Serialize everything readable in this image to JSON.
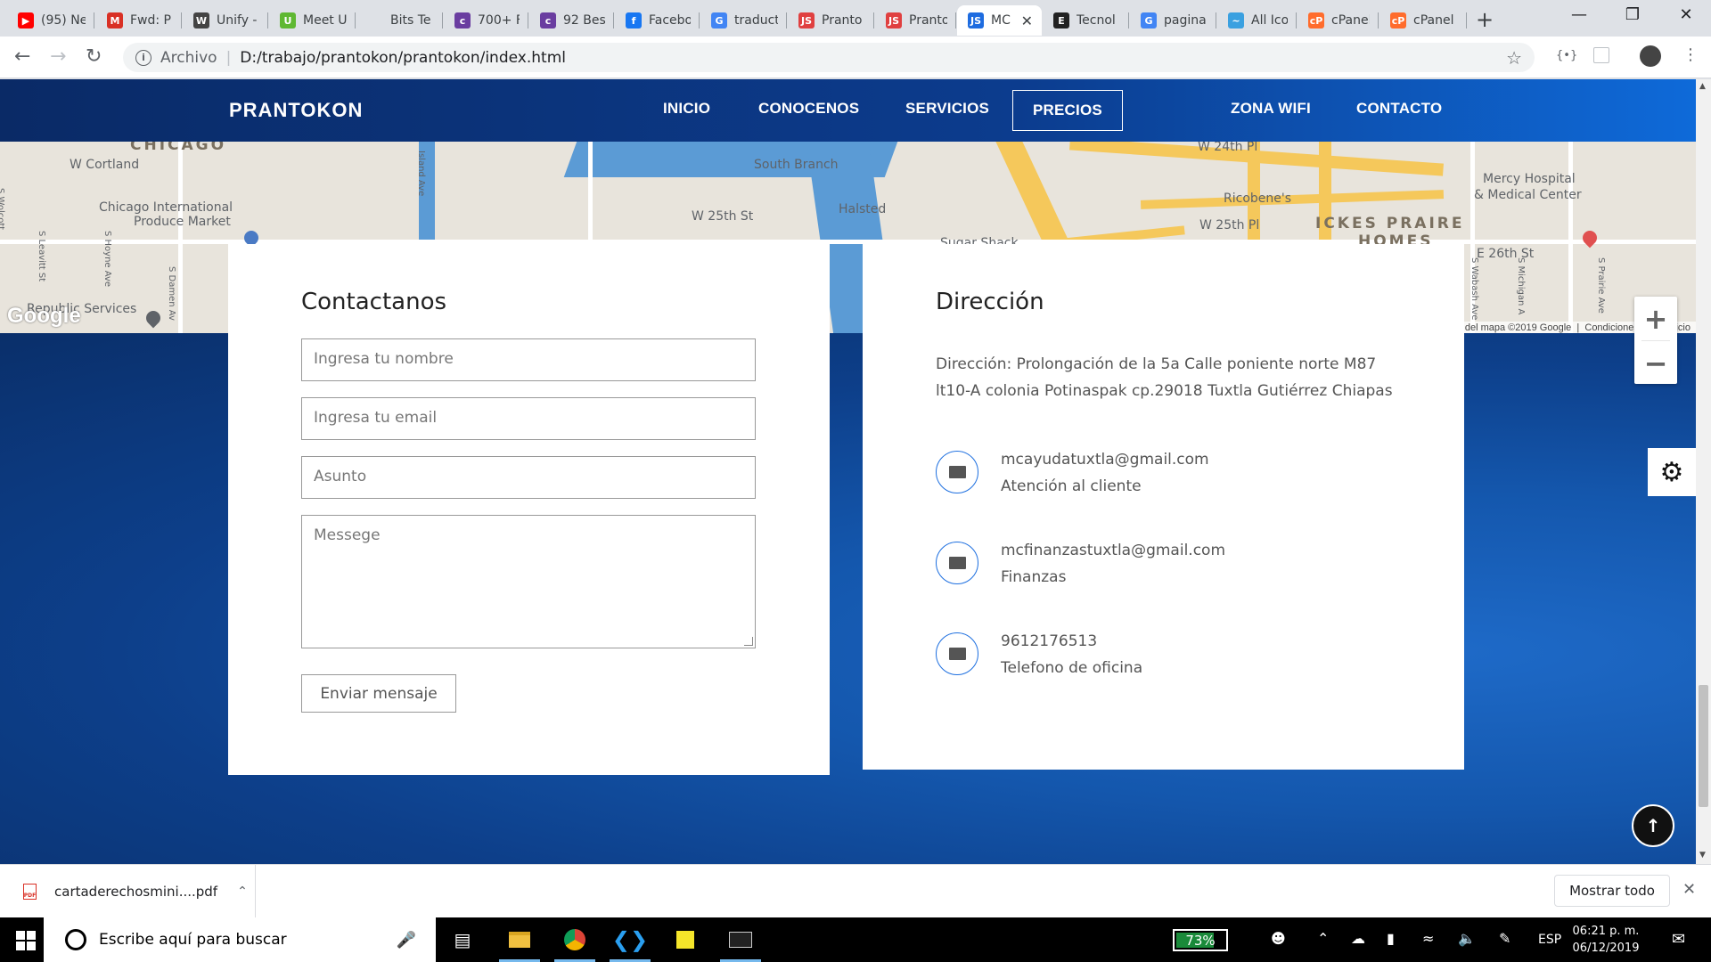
{
  "browser": {
    "tabs": [
      {
        "label": "(95) Ne",
        "icon": "▶",
        "color": "#ff0000"
      },
      {
        "label": "Fwd: P",
        "icon": "M",
        "color": "#d93025"
      },
      {
        "label": "Unify -",
        "icon": "W",
        "color": "#444444"
      },
      {
        "label": "Meet U",
        "icon": "U",
        "color": "#5fb832"
      },
      {
        "label": "Bits Te",
        "icon": "",
        "color": "#dee1e6"
      },
      {
        "label": "700+ F",
        "icon": "c",
        "color": "#6a3da0"
      },
      {
        "label": "92 Bes",
        "icon": "c",
        "color": "#6a3da0"
      },
      {
        "label": "Facebo",
        "icon": "f",
        "color": "#1877f2"
      },
      {
        "label": "traduct",
        "icon": "G",
        "color": "#4285f4"
      },
      {
        "label": "Pranto",
        "icon": "JS",
        "color": "#e04040"
      },
      {
        "label": "Pranto",
        "icon": "JS",
        "color": "#e04040"
      },
      {
        "label": "MC",
        "icon": "JS",
        "color": "#1e6ce0"
      },
      {
        "label": "Tecnol",
        "icon": "E",
        "color": "#222222"
      },
      {
        "label": "pagina",
        "icon": "G",
        "color": "#4285f4"
      },
      {
        "label": "All Icor",
        "icon": "~",
        "color": "#3aa0e0"
      },
      {
        "label": "cPanel",
        "icon": "cP",
        "color": "#ff6c2c"
      },
      {
        "label": "cPanel",
        "icon": "cP",
        "color": "#ff6c2c"
      }
    ],
    "active_tab": 11,
    "address": {
      "scheme_label": "Archivo",
      "url": "D:/trabajo/prantokon/prantokon/index.html"
    }
  },
  "site": {
    "brand": "PRANTOKON",
    "nav": [
      {
        "label": "INICIO",
        "active": false
      },
      {
        "label": "CONOCENOS",
        "active": false
      },
      {
        "label": "SERVICIOS",
        "active": false
      },
      {
        "label": "PRECIOS",
        "active": true
      },
      {
        "label": "ZONA WIFI",
        "active": false
      },
      {
        "label": "CONTACTO",
        "active": false
      }
    ],
    "map": {
      "labels": [
        "CHICAGO",
        "W Cortland",
        "Chicago International",
        "Produce Market",
        "W 25th St",
        "South Branch",
        "Halsted",
        "Sugar Shack",
        "W 24th Pl",
        "W 25th Pl",
        "Ricobene's",
        "ICKES PRAIRE",
        "HOMES",
        "Mercy Hospital",
        "& Medical Center",
        "E 26th St",
        "Republic Services",
        "S Damen Av",
        "S Leavitt St",
        "S Hoyne Ave",
        "S Wabash Ave",
        "S Michigan A",
        "S Prairie Ave",
        "S Wolcott",
        "Island Ave"
      ],
      "logo": "Google",
      "copyright": "Datos del mapa ©2019 Google",
      "terms": "Condiciones del servicio"
    },
    "contact_form": {
      "title": "Contactanos",
      "name_placeholder": "Ingresa tu nombre",
      "email_placeholder": "Ingresa tu email",
      "subject_placeholder": "Asunto",
      "message_placeholder": "Messege",
      "submit_label": "Enviar mensaje"
    },
    "address_card": {
      "title": "Dirección",
      "address": "Dirección: Prolongación de la 5a Calle poniente norte M87 lt10-A colonia Potinaspak cp.29018 Tuxtla Gutiérrez Chiapas",
      "contacts": [
        {
          "value": "mcayudatuxtla@gmail.com",
          "label": "Atención al cliente"
        },
        {
          "value": "mcfinanzastuxtla@gmail.com",
          "label": "Finanzas"
        },
        {
          "value": "9612176513",
          "label": "Telefono de oficina"
        }
      ]
    }
  },
  "downloads": {
    "file": "cartaderechosmini....pdf",
    "show_all": "Mostrar todo"
  },
  "taskbar": {
    "search_placeholder": "Escribe aquí para buscar",
    "battery": "73%",
    "battery_level": 0.73,
    "language": "ESP",
    "time": "06:21 p. m.",
    "date": "06/12/2019"
  }
}
